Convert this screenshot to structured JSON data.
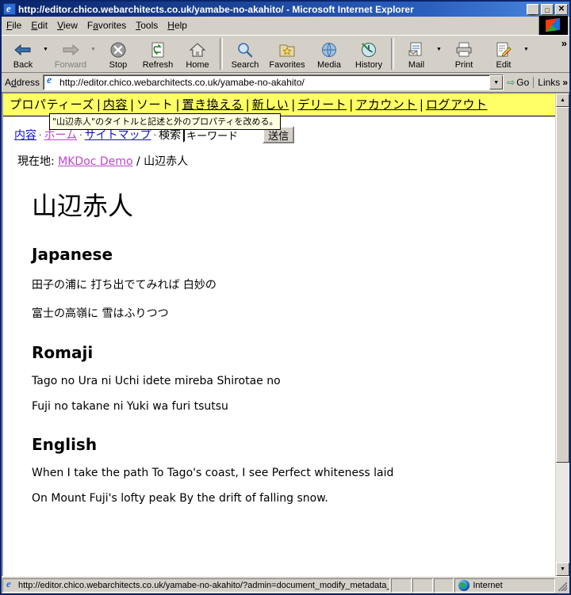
{
  "window": {
    "title": "http://editor.chico.webarchitects.co.uk/yamabe-no-akahito/ - Microsoft Internet Explorer",
    "minimize_label": "_",
    "maximize_label": "□",
    "close_label": "✕"
  },
  "menubar": {
    "items": [
      {
        "label": "File"
      },
      {
        "label": "Edit"
      },
      {
        "label": "View"
      },
      {
        "label": "Favorites"
      },
      {
        "label": "Tools"
      },
      {
        "label": "Help"
      }
    ]
  },
  "toolbar": {
    "overflow_label": "»",
    "buttons": [
      {
        "label": "Back",
        "icon": "back-arrow-icon",
        "disabled": false,
        "dropdown": true
      },
      {
        "label": "Forward",
        "icon": "forward-arrow-icon",
        "disabled": true,
        "dropdown": true
      },
      {
        "label": "Stop",
        "icon": "stop-icon",
        "disabled": false,
        "dropdown": false
      },
      {
        "label": "Refresh",
        "icon": "refresh-icon",
        "disabled": false,
        "dropdown": false
      },
      {
        "label": "Home",
        "icon": "home-icon",
        "disabled": false,
        "dropdown": false
      },
      {
        "label": "Search",
        "icon": "search-icon",
        "disabled": false,
        "dropdown": false
      },
      {
        "label": "Favorites",
        "icon": "favorites-icon",
        "disabled": false,
        "dropdown": false
      },
      {
        "label": "Media",
        "icon": "media-icon",
        "disabled": false,
        "dropdown": false
      },
      {
        "label": "History",
        "icon": "history-icon",
        "disabled": false,
        "dropdown": false
      },
      {
        "label": "Mail",
        "icon": "mail-icon",
        "disabled": false,
        "dropdown": true
      },
      {
        "label": "Print",
        "icon": "print-icon",
        "disabled": false,
        "dropdown": false
      },
      {
        "label": "Edit",
        "icon": "edit-icon",
        "disabled": false,
        "dropdown": true
      }
    ]
  },
  "address": {
    "label": "Address",
    "value": "http://editor.chico.webarchitects.co.uk/yamabe-no-akahito/",
    "placeholder": "",
    "go_label": "Go",
    "links_label": "Links",
    "links_chevron": "»",
    "dropdown_glyph": "▼"
  },
  "admin_bar": {
    "items": [
      {
        "label": "プロパティーズ",
        "hovered": true
      },
      {
        "label": "内容",
        "hovered": false
      },
      {
        "label": "ソート",
        "hovered": false
      },
      {
        "label": "置き換える",
        "hovered": false
      },
      {
        "label": "新しい",
        "hovered": false
      },
      {
        "label": "デリート",
        "hovered": false
      },
      {
        "label": "アカウント",
        "hovered": false
      },
      {
        "label": "ログアウト",
        "hovered": false
      }
    ],
    "separator": "|"
  },
  "tooltip": {
    "text": "\"山辺赤人\"のタイトルと記述と外のプロパティを改める。"
  },
  "site_nav": {
    "links": [
      {
        "label": "内容",
        "state": "link"
      },
      {
        "label": "ホーム",
        "state": "visited"
      },
      {
        "label": "サイトマップ",
        "state": "link"
      }
    ],
    "separator": "·",
    "search_label": "検索",
    "search_value": "キーワード",
    "search_placeholder": "キーワード",
    "submit_label": "送信"
  },
  "breadcrumb": {
    "prefix": "現在地:",
    "home_label": "MKDoc Demo",
    "separator": "/",
    "current": "山辺赤人"
  },
  "document": {
    "title": "山辺赤人",
    "sections": [
      {
        "heading": "Japanese",
        "lines": [
          "田子の浦に 打ち出でてみれば 白妙の",
          "富士の高嶺に 雪はふりつつ"
        ]
      },
      {
        "heading": "Romaji",
        "lines": [
          "Tago no Ura ni Uchi idete mireba Shirotae no",
          "Fuji no takane ni Yuki wa furi tsutsu"
        ]
      },
      {
        "heading": "English",
        "lines": [
          "When I take the path To Tago's coast, I see Perfect whiteness laid",
          "On Mount Fuji's lofty peak By the drift of falling snow."
        ]
      }
    ]
  },
  "statusbar": {
    "url": "http://editor.chico.webarchitects.co.uk/yamabe-no-akahito/?admin=document_modify_metadata_f",
    "zone": "Internet"
  },
  "scrollbar": {
    "up_glyph": "▲",
    "down_glyph": "▼"
  },
  "colors": {
    "admin_bar_bg": "#ffff66",
    "link": "#1111cc",
    "visited": "#bb44cc",
    "titlebar": "#0a246a",
    "chrome": "#d4d0c8"
  }
}
